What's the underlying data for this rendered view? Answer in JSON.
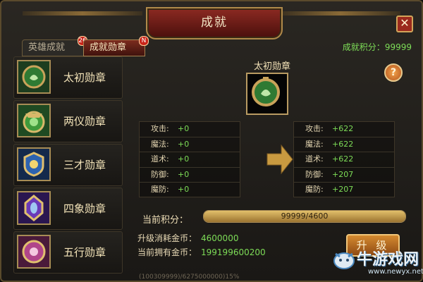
{
  "window": {
    "title": "成就",
    "close_label": "✕"
  },
  "tabs": [
    {
      "label": "英雄成就",
      "badge": "26"
    },
    {
      "label": "成就勋章",
      "badge": "N"
    }
  ],
  "score": {
    "label": "成就积分：",
    "value": "99999"
  },
  "medals": [
    {
      "name": "太初勋章",
      "icon": "medal-green-icon",
      "color": "#2f7a33"
    },
    {
      "name": "两仪勋章",
      "icon": "medal-jade-icon",
      "color": "#3f9a3b"
    },
    {
      "name": "三才勋章",
      "icon": "medal-blue-icon",
      "color": "#2d63b0"
    },
    {
      "name": "四象勋章",
      "icon": "medal-purple-icon",
      "color": "#6a3ab8"
    },
    {
      "name": "五行勋章",
      "icon": "medal-pink-icon",
      "color": "#b0458a"
    }
  ],
  "detail": {
    "title": "太初勋章",
    "help_label": "?",
    "current_stats": [
      {
        "label": "攻击:",
        "value": "+0"
      },
      {
        "label": "魔法:",
        "value": "+0"
      },
      {
        "label": "道术:",
        "value": "+0"
      },
      {
        "label": "防御:",
        "value": "+0"
      },
      {
        "label": "魔防:",
        "value": "+0"
      }
    ],
    "next_stats": [
      {
        "label": "攻击:",
        "value": "+622"
      },
      {
        "label": "魔法:",
        "value": "+622"
      },
      {
        "label": "道术:",
        "value": "+622"
      },
      {
        "label": "防御:",
        "value": "+207"
      },
      {
        "label": "魔防:",
        "value": "+207"
      }
    ]
  },
  "progress": {
    "label": "当前积分：",
    "text": "99999/4600",
    "fraction": 1.0
  },
  "cost": {
    "upgrade_label": "升级消耗金币：",
    "upgrade_value": "4600000",
    "owned_label": "当前拥有金币：",
    "owned_value": "199199600200"
  },
  "upgrade_button": "升 级",
  "footer_text": "(100309999)/6275000000)15%",
  "watermark": {
    "name": "牛游戏网",
    "url": "www.newyx.net"
  }
}
